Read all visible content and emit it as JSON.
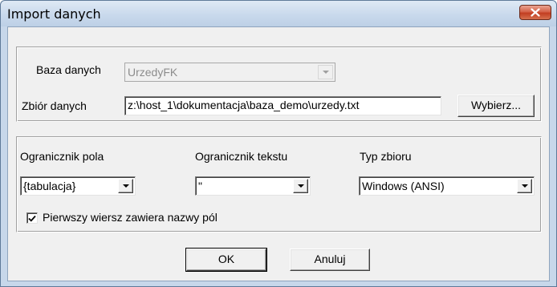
{
  "window": {
    "title": "Import danych"
  },
  "database_group": {
    "baza_label": "Baza danych",
    "baza_value": "UrzedyFK",
    "zbior_label": "Zbiór danych",
    "zbior_value": "z:\\host_1\\dokumentacja\\baza_demo\\urzedy.txt",
    "browse_button": "Wybierz..."
  },
  "options_group": {
    "field_delimiter_label": "Ogranicznik pola",
    "field_delimiter_value": "{tabulacja}",
    "text_delimiter_label": "Ogranicznik tekstu",
    "text_delimiter_value": "\"",
    "file_type_label": "Typ zbioru",
    "file_type_value": "Windows (ANSI)",
    "header_checkbox_label": "Pierwszy wiersz zawiera nazwy pól",
    "header_checkbox_checked": true
  },
  "buttons": {
    "ok": "OK",
    "cancel": "Anuluj"
  }
}
